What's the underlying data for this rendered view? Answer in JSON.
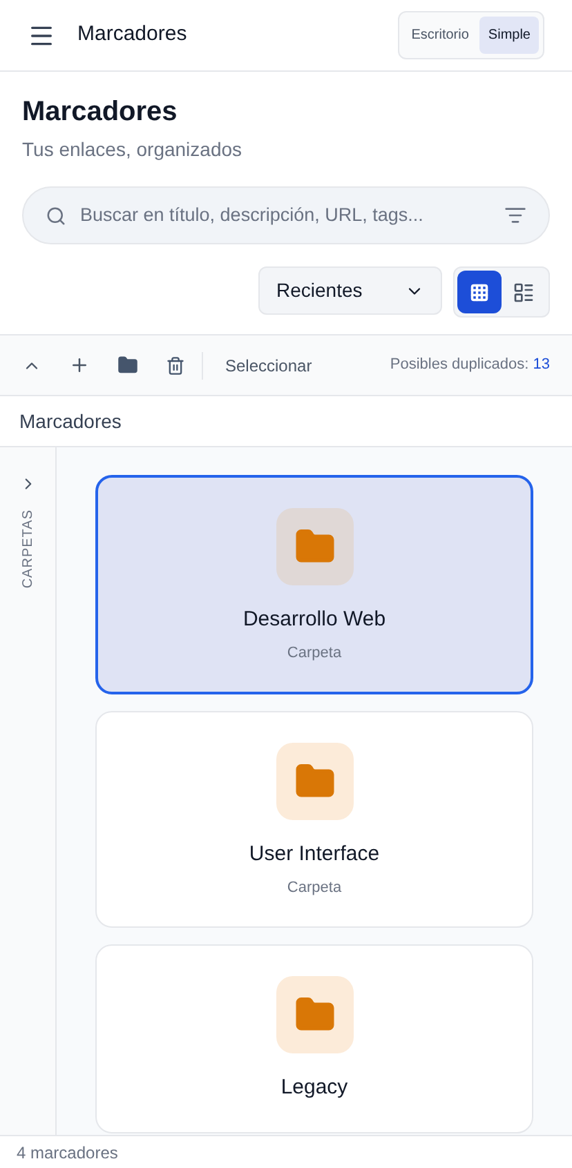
{
  "header": {
    "title": "Marcadores",
    "modes": [
      {
        "label": "Escritorio",
        "selected": false
      },
      {
        "label": "Simple",
        "selected": true
      }
    ]
  },
  "page": {
    "title": "Marcadores",
    "subtitle": "Tus enlaces, organizados"
  },
  "search": {
    "placeholder": "Buscar en título, descripción, URL, tags..."
  },
  "sort": {
    "value": "Recientes"
  },
  "views": [
    {
      "kind": "grid",
      "selected": true
    },
    {
      "kind": "list",
      "selected": false
    }
  ],
  "toolbar": {
    "select": "Seleccionar",
    "duplicates_label": "Posibles duplicados:",
    "duplicates_count": "13"
  },
  "breadcrumb": "Marcadores",
  "sidebar": {
    "label": "CARPETAS",
    "expanded": false
  },
  "folders": [
    {
      "name": "Desarrollo Web",
      "type": "Carpeta",
      "selected": true
    },
    {
      "name": "User Interface",
      "type": "Carpeta",
      "selected": false
    },
    {
      "name": "Legacy",
      "selected": false
    }
  ],
  "status_bar": "4 marcadores"
}
